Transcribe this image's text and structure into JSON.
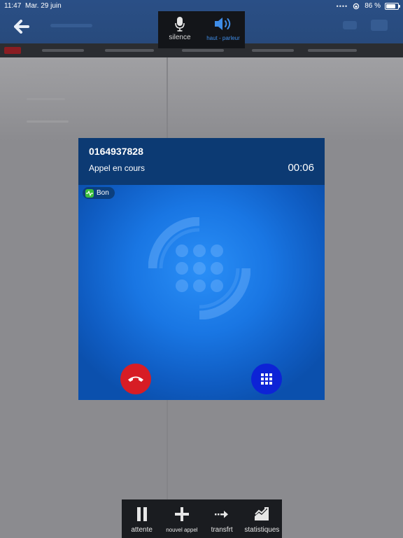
{
  "status_bar": {
    "time": "11:47",
    "date": "Mar. 29 juin",
    "battery": "86 %"
  },
  "audio_bar": {
    "mute_label": "silence",
    "speaker_label": "haut - parleur"
  },
  "call": {
    "number": "0164937828",
    "status": "Appel en cours",
    "timer": "00:06",
    "quality": "Bon"
  },
  "toolbar": {
    "hold_label": "attente",
    "new_call_label": "nouvel appel",
    "transfer_label": "transfrt",
    "stats_label": "statistiques"
  },
  "colors": {
    "header": "#0c3a73",
    "panel": "#1976e3",
    "hangup": "#d71d25",
    "keypad": "#0d23d6",
    "speaker_active": "#3f8de8",
    "quality": "#3bbf3b"
  }
}
